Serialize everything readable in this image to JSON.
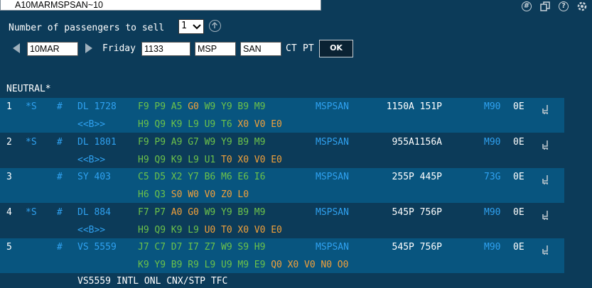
{
  "command": {
    "value": "A10MARMSPSAN~10"
  },
  "toolbar_icons": [
    "hash-circle-icon",
    "copy-icon",
    "help-icon",
    "settings-icon"
  ],
  "availability_form": {
    "passengers_label": "Number of passengers to sell",
    "passengers_value": "1",
    "date": "10MAR",
    "day": "Friday",
    "time": "1133",
    "origin": "MSP",
    "destination": "SAN",
    "ct": "CT",
    "pt": "PT",
    "ok_label": "OK"
  },
  "section_title": "NEUTRAL*",
  "rows": [
    {
      "num": "1",
      "flag": "*S",
      "hash": "#",
      "flight": "DL 1728",
      "line1": [
        {
          "t": "F9",
          "c": "g"
        },
        {
          "t": "P9",
          "c": "g"
        },
        {
          "t": "A5",
          "c": "g"
        },
        {
          "t": "G0",
          "c": "o"
        },
        {
          "t": "W9",
          "c": "g"
        },
        {
          "t": "Y9",
          "c": "g"
        },
        {
          "t": "B9",
          "c": "g"
        },
        {
          "t": "M9",
          "c": "g"
        }
      ],
      "link": "<<B>>",
      "line2": [
        {
          "t": "H9",
          "c": "g"
        },
        {
          "t": "Q9",
          "c": "g"
        },
        {
          "t": "K9",
          "c": "g"
        },
        {
          "t": "L9",
          "c": "g"
        },
        {
          "t": "U9",
          "c": "g"
        },
        {
          "t": "T6",
          "c": "g"
        },
        {
          "t": "X0",
          "c": "o"
        },
        {
          "t": "V0",
          "c": "o"
        },
        {
          "t": "E0",
          "c": "o"
        }
      ],
      "route": "MSPSAN",
      "times": "1150A 151P",
      "equipment": "M90",
      "stops": "0E"
    },
    {
      "num": "2",
      "flag": "*S",
      "hash": "#",
      "flight": "DL 1801",
      "line1": [
        {
          "t": "F9",
          "c": "g"
        },
        {
          "t": "P9",
          "c": "g"
        },
        {
          "t": "A9",
          "c": "g"
        },
        {
          "t": "G7",
          "c": "g"
        },
        {
          "t": "W9",
          "c": "g"
        },
        {
          "t": "Y9",
          "c": "g"
        },
        {
          "t": "B9",
          "c": "g"
        },
        {
          "t": "M9",
          "c": "g"
        }
      ],
      "link": "<<B>>",
      "line2": [
        {
          "t": "H9",
          "c": "g"
        },
        {
          "t": "Q9",
          "c": "g"
        },
        {
          "t": "K9",
          "c": "g"
        },
        {
          "t": "L9",
          "c": "g"
        },
        {
          "t": "U1",
          "c": "g"
        },
        {
          "t": "T0",
          "c": "o"
        },
        {
          "t": "X0",
          "c": "o"
        },
        {
          "t": "V0",
          "c": "o"
        },
        {
          "t": "E0",
          "c": "o"
        }
      ],
      "route": "MSPSAN",
      "times": "955A1156A",
      "equipment": "M90",
      "stops": "0E"
    },
    {
      "num": "3",
      "flag": "",
      "hash": "#",
      "flight": "SY 403",
      "line1": [
        {
          "t": "C5",
          "c": "g"
        },
        {
          "t": "D5",
          "c": "g"
        },
        {
          "t": "X2",
          "c": "g"
        },
        {
          "t": "Y7",
          "c": "g"
        },
        {
          "t": "B6",
          "c": "g"
        },
        {
          "t": "M6",
          "c": "g"
        },
        {
          "t": "E6",
          "c": "g"
        },
        {
          "t": "I6",
          "c": "g"
        }
      ],
      "link": "",
      "line2": [
        {
          "t": "H6",
          "c": "g"
        },
        {
          "t": "Q3",
          "c": "g"
        },
        {
          "t": "S0",
          "c": "o"
        },
        {
          "t": "W0",
          "c": "o"
        },
        {
          "t": "V0",
          "c": "o"
        },
        {
          "t": "Z0",
          "c": "o"
        },
        {
          "t": "L0",
          "c": "o"
        }
      ],
      "route": "MSPSAN",
      "times": "255P 445P",
      "equipment": "73G",
      "stops": "0E"
    },
    {
      "num": "4",
      "flag": "*S",
      "hash": "#",
      "flight": "DL 884",
      "line1": [
        {
          "t": "F7",
          "c": "g"
        },
        {
          "t": "P7",
          "c": "g"
        },
        {
          "t": "A0",
          "c": "o"
        },
        {
          "t": "G0",
          "c": "o"
        },
        {
          "t": "W9",
          "c": "g"
        },
        {
          "t": "Y9",
          "c": "g"
        },
        {
          "t": "B9",
          "c": "g"
        },
        {
          "t": "M9",
          "c": "g"
        }
      ],
      "link": "<<B>>",
      "line2": [
        {
          "t": "H9",
          "c": "g"
        },
        {
          "t": "Q9",
          "c": "g"
        },
        {
          "t": "K9",
          "c": "g"
        },
        {
          "t": "L9",
          "c": "g"
        },
        {
          "t": "U0",
          "c": "o"
        },
        {
          "t": "T0",
          "c": "o"
        },
        {
          "t": "X0",
          "c": "o"
        },
        {
          "t": "V0",
          "c": "o"
        },
        {
          "t": "E0",
          "c": "o"
        }
      ],
      "route": "MSPSAN",
      "times": "545P 756P",
      "equipment": "M90",
      "stops": "0E"
    },
    {
      "num": "5",
      "flag": "",
      "hash": "#",
      "flight": "VS 5559",
      "line1": [
        {
          "t": "J7",
          "c": "g"
        },
        {
          "t": "C7",
          "c": "g"
        },
        {
          "t": "D7",
          "c": "g"
        },
        {
          "t": "I7",
          "c": "g"
        },
        {
          "t": "Z7",
          "c": "g"
        },
        {
          "t": "W9",
          "c": "g"
        },
        {
          "t": "S9",
          "c": "g"
        },
        {
          "t": "H9",
          "c": "g"
        }
      ],
      "link": "",
      "line2": [
        {
          "t": "K9",
          "c": "g"
        },
        {
          "t": "Y9",
          "c": "g"
        },
        {
          "t": "B9",
          "c": "g"
        },
        {
          "t": "R9",
          "c": "g"
        },
        {
          "t": "L9",
          "c": "g"
        },
        {
          "t": "U9",
          "c": "g"
        },
        {
          "t": "M9",
          "c": "g"
        },
        {
          "t": "E9",
          "c": "g"
        },
        {
          "t": "Q0",
          "c": "o"
        },
        {
          "t": "X0",
          "c": "o"
        },
        {
          "t": "V0",
          "c": "o"
        },
        {
          "t": "N0",
          "c": "o"
        },
        {
          "t": "O0",
          "c": "o"
        }
      ],
      "route": "MSPSAN",
      "times": "545P 756P",
      "equipment": "M90",
      "stops": "0E"
    }
  ],
  "footer_note": "VS5559 INTL ONL CNX/STP TFC",
  "colors": {
    "background": "#0c3b59",
    "band": "#08557f",
    "blue": "#2fa1f0",
    "green": "#6cc24a",
    "orange": "#f2a13a"
  }
}
